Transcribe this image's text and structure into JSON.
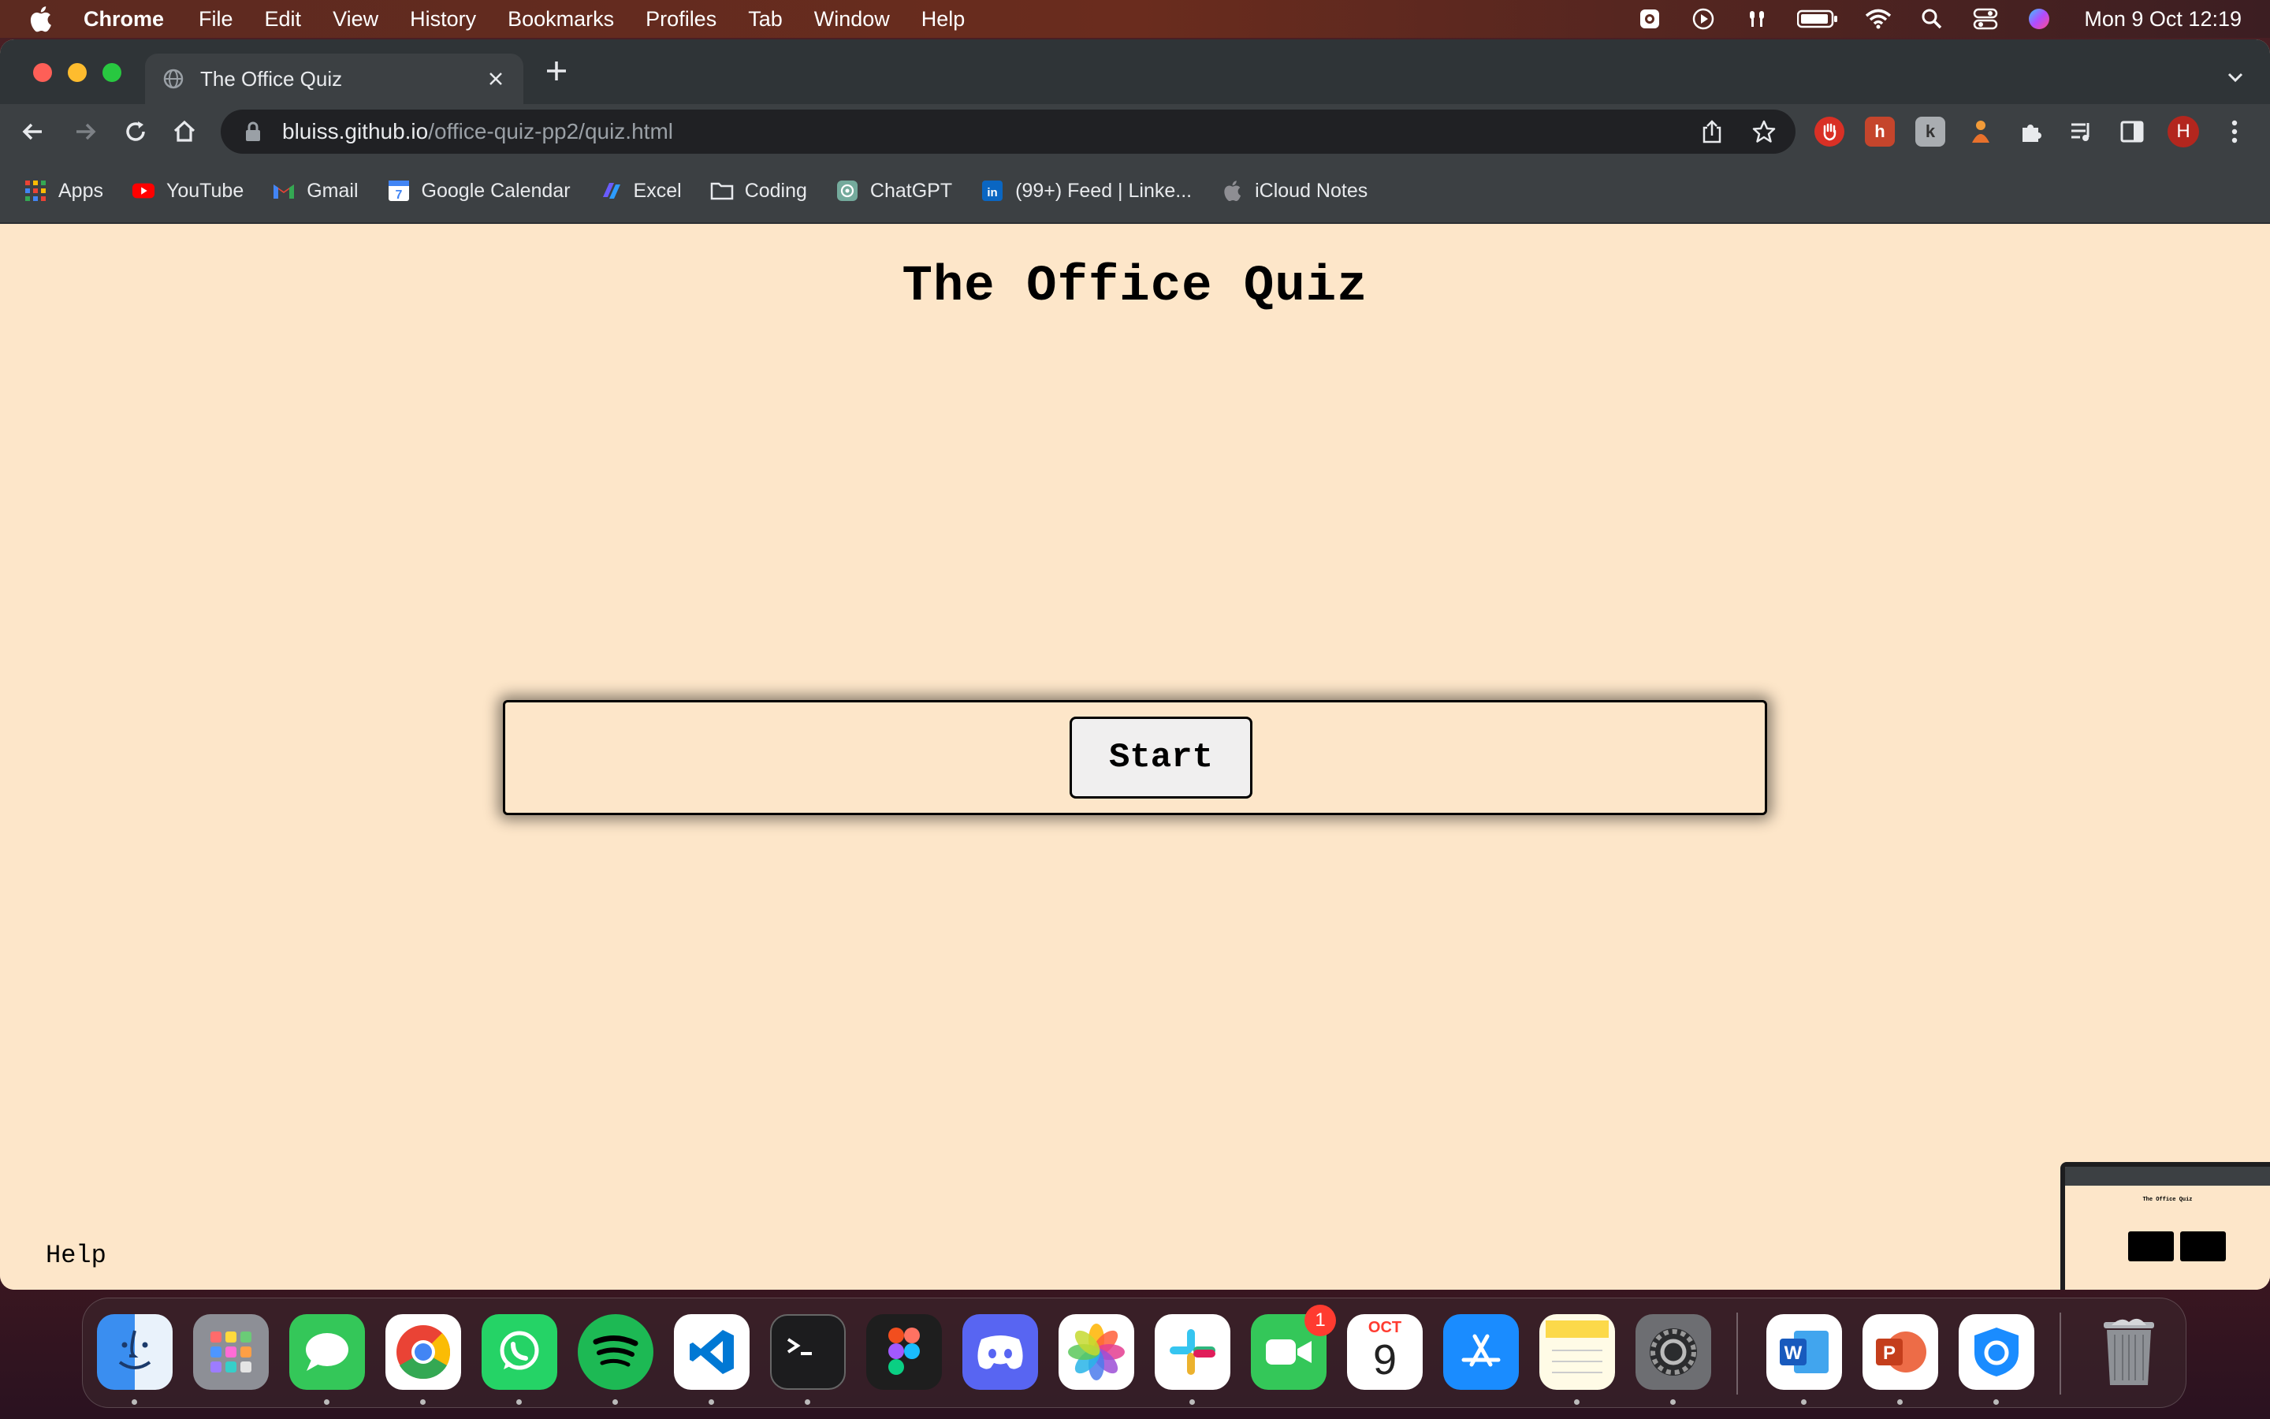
{
  "menubar": {
    "app_name": "Chrome",
    "items": [
      "File",
      "Edit",
      "View",
      "History",
      "Bookmarks",
      "Profiles",
      "Tab",
      "Window",
      "Help"
    ],
    "clock": "Mon 9 Oct  12:19"
  },
  "browser": {
    "tab_title": "The Office Quiz",
    "url_host": "bluiss.github.io",
    "url_path": "/office-quiz-pp2/quiz.html",
    "profile_initial": "H",
    "bookmarks": [
      "Apps",
      "YouTube",
      "Gmail",
      "Google Calendar",
      "Excel",
      "Coding",
      "ChatGPT",
      "(99+) Feed | Linke...",
      "iCloud Notes"
    ]
  },
  "page": {
    "title": "The Office Quiz",
    "start_label": "Start",
    "help_label": "Help"
  },
  "thumbnail": {
    "title": "The Office Quiz"
  },
  "dock": {
    "calendar_month": "OCT",
    "calendar_day": "9",
    "facetime_badge": "1"
  },
  "colors": {
    "page_background": "#fde6c9",
    "tab_strip": "#2f3437",
    "toolbar": "#3c4043"
  }
}
